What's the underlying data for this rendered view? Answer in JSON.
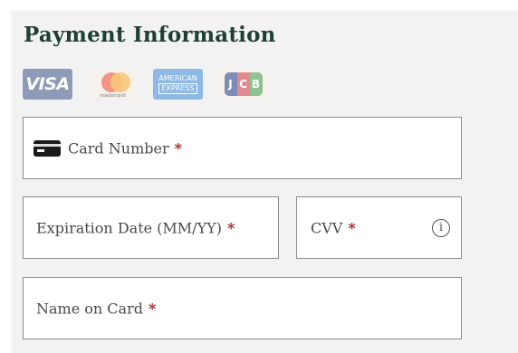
{
  "form": {
    "title": "Payment Information",
    "card_brands": [
      {
        "name": "visa",
        "text": "VISA"
      },
      {
        "name": "mastercard",
        "text": "mastercard"
      },
      {
        "name": "american-express",
        "line1": "AMERICAN",
        "line2": "EXPRESS"
      },
      {
        "name": "jcb",
        "letters": [
          "J",
          "C",
          "B"
        ]
      }
    ],
    "fields": {
      "card_number": {
        "label": "Card Number",
        "required": "*",
        "icon": "credit-card-icon"
      },
      "expiration": {
        "label": "Expiration Date (MM/YY)",
        "required": "*"
      },
      "cvv": {
        "label": "CVV",
        "required": "*",
        "info_glyph": "i",
        "icon": "info-icon"
      },
      "name_on_card": {
        "label": "Name on Card",
        "required": "*"
      }
    }
  },
  "colors": {
    "title": "#1f3f34",
    "required": "#a02323",
    "panel_bg": "#f2f2f2",
    "field_border": "#8d8d8d"
  }
}
